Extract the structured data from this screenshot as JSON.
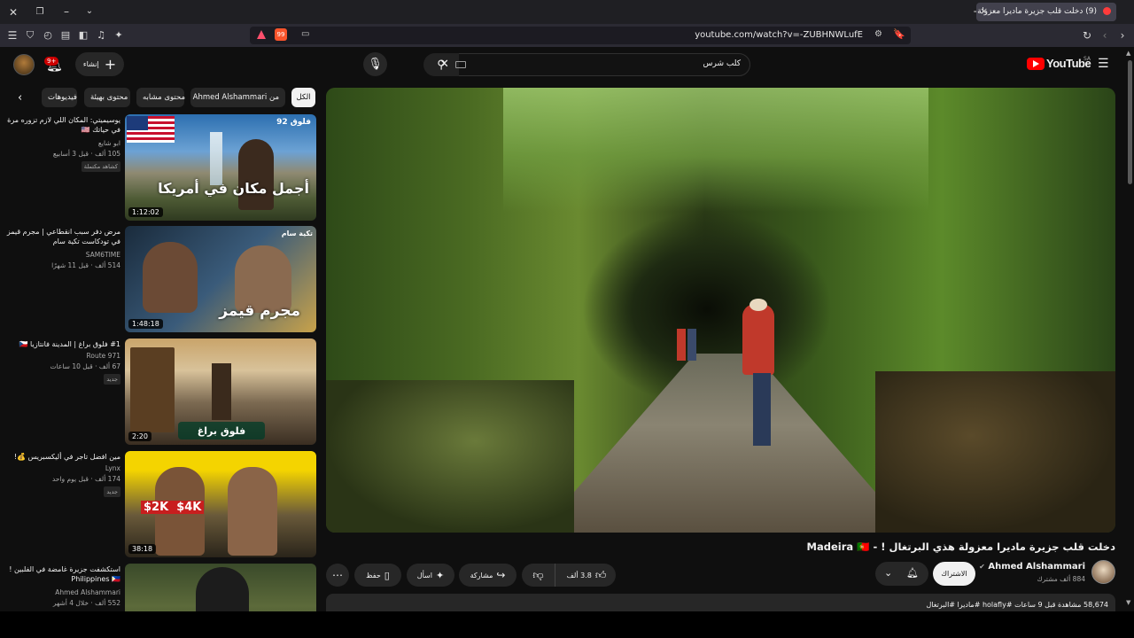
{
  "browser": {
    "tab_title": "(9) دخلت قلب جزيرة ماديرا معزولة هذي البرتغال ! - Madeira",
    "url": "youtube.com/watch?v=-ZUBHNWLufE",
    "new_tab_icon": "+",
    "tab_close_icon": "×"
  },
  "header": {
    "logo": "YouTube",
    "logo_region": "SA",
    "search_value": "كلب شرس",
    "create_label": "إنشاء",
    "notifications_count": "9+"
  },
  "chips": [
    "الكل",
    "من Ahmed Alshammari",
    "محتوى مشابه",
    "محتوى بهيئة",
    "فيديوهات"
  ],
  "recommendations": [
    {
      "title": "يوسيميتي: المكان اللي لازم تزوره مرة في حياتك 🇺🇸",
      "channel": "ابو شايع",
      "meta": "105 ألف · قبل 3 أسابيع",
      "badge": "كشاهد مكتملة",
      "duration": "1:12:02",
      "thumb_text": "أجمل مكان في أمريكا",
      "thumb_top": "فلوق 92"
    },
    {
      "title": "مرض دفر سبب انقطاعي | مجرم قيمز في تودكاست تكية سام",
      "channel": "SAM6TIME",
      "meta": "514 ألف · قبل 11 شهرًا",
      "badge": "",
      "duration": "1:48:18",
      "thumb_text": "مجرم قيمز",
      "thumb_top": "تكية سام"
    },
    {
      "title": "#1 فلوق براغ | المدينة فانتازيا 🇨🇿",
      "channel": "Route 971",
      "meta": "67 ألف · قبل 10 ساعات",
      "badge": "جديد",
      "duration": "2:20",
      "thumb_text": "فلوق براغ",
      "thumb_top": ""
    },
    {
      "title": "مين افضل تاجر في أليكسبريس 💰!",
      "channel": "Lynx",
      "meta": "174 ألف · قبل يوم واحد",
      "badge": "جديد",
      "duration": "38:18",
      "thumb_text": "$2K  $4K",
      "thumb_top": ""
    },
    {
      "title": "استكشفت جزيرة غامضة في الفلبين ! Philippines 🇵🇭",
      "channel": "Ahmed Alshammari",
      "meta": "552 ألف · خلال 4 أشهر",
      "badge": "",
      "duration": "",
      "thumb_text": "",
      "thumb_top": ""
    }
  ],
  "video": {
    "title": "دخلت قلب جزيرة ماديرا معزولة هذي البرتغال ! - Madeira 🇵🇹",
    "channel": "Ahmed Alshammari",
    "subscribers": "884 ألف مشترك",
    "subscribe_label": "الاشتراك",
    "likes": "3.8 ألف",
    "share_label": "مشاركة",
    "ask_label": "اسأل",
    "save_label": "حفظ",
    "description_line": "58,674 مشاهدة قبل 9 ساعات #holafly #ماديرا #البرتغال"
  },
  "colors": {
    "bg": "#0f0f0f",
    "chip_bg": "#272727",
    "youtube_red": "#ff0000",
    "subscribe_bg": "#f1f1f1"
  }
}
